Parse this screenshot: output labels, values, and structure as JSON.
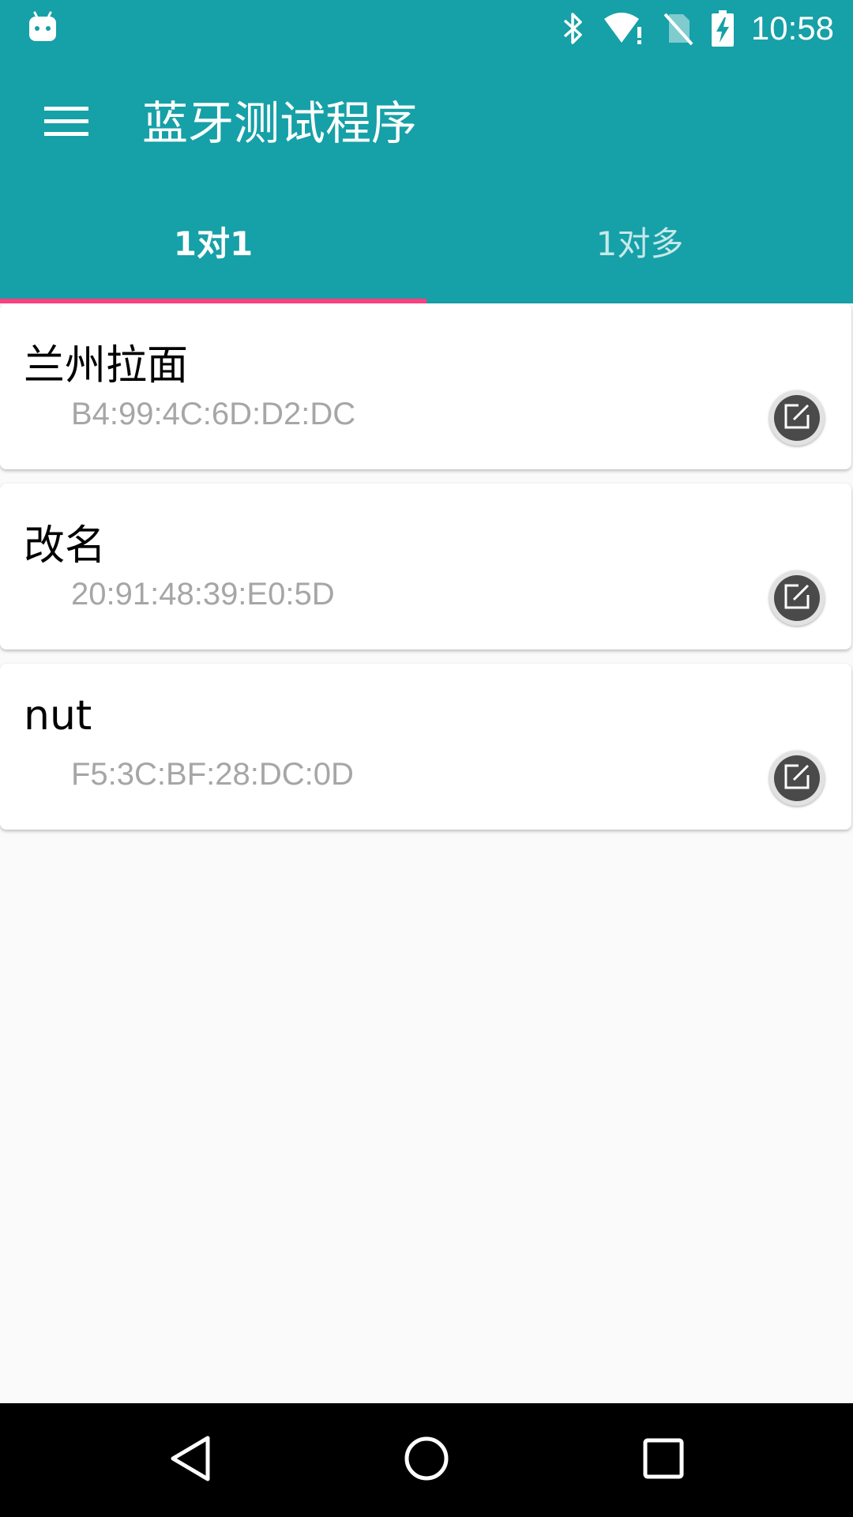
{
  "status_bar": {
    "time": "10:58",
    "icons": [
      "android-notification-icon",
      "bluetooth-icon",
      "wifi-no-internet-icon",
      "no-sim-icon",
      "battery-charging-icon"
    ]
  },
  "app_bar": {
    "title": "蓝牙测试程序",
    "menu_icon": "hamburger-menu-icon"
  },
  "tabs": [
    {
      "label": "1对1",
      "active": true
    },
    {
      "label": "1对多",
      "active": false
    }
  ],
  "devices": [
    {
      "name": "兰州拉面",
      "address": "B4:99:4C:6D:D2:DC",
      "edit_icon": "edit-icon"
    },
    {
      "name": "改名",
      "address": "20:91:48:39:E0:5D",
      "edit_icon": "edit-icon"
    },
    {
      "name": "nut",
      "address": "F5:3C:BF:28:DC:0D",
      "edit_icon": "edit-icon"
    }
  ],
  "nav_bar": {
    "buttons": [
      "back-icon",
      "home-icon",
      "recents-icon"
    ]
  },
  "colors": {
    "primary": "#16a0a7",
    "accent": "#ff4081",
    "address_text": "#a6a6a6",
    "background": "#fafafa"
  }
}
